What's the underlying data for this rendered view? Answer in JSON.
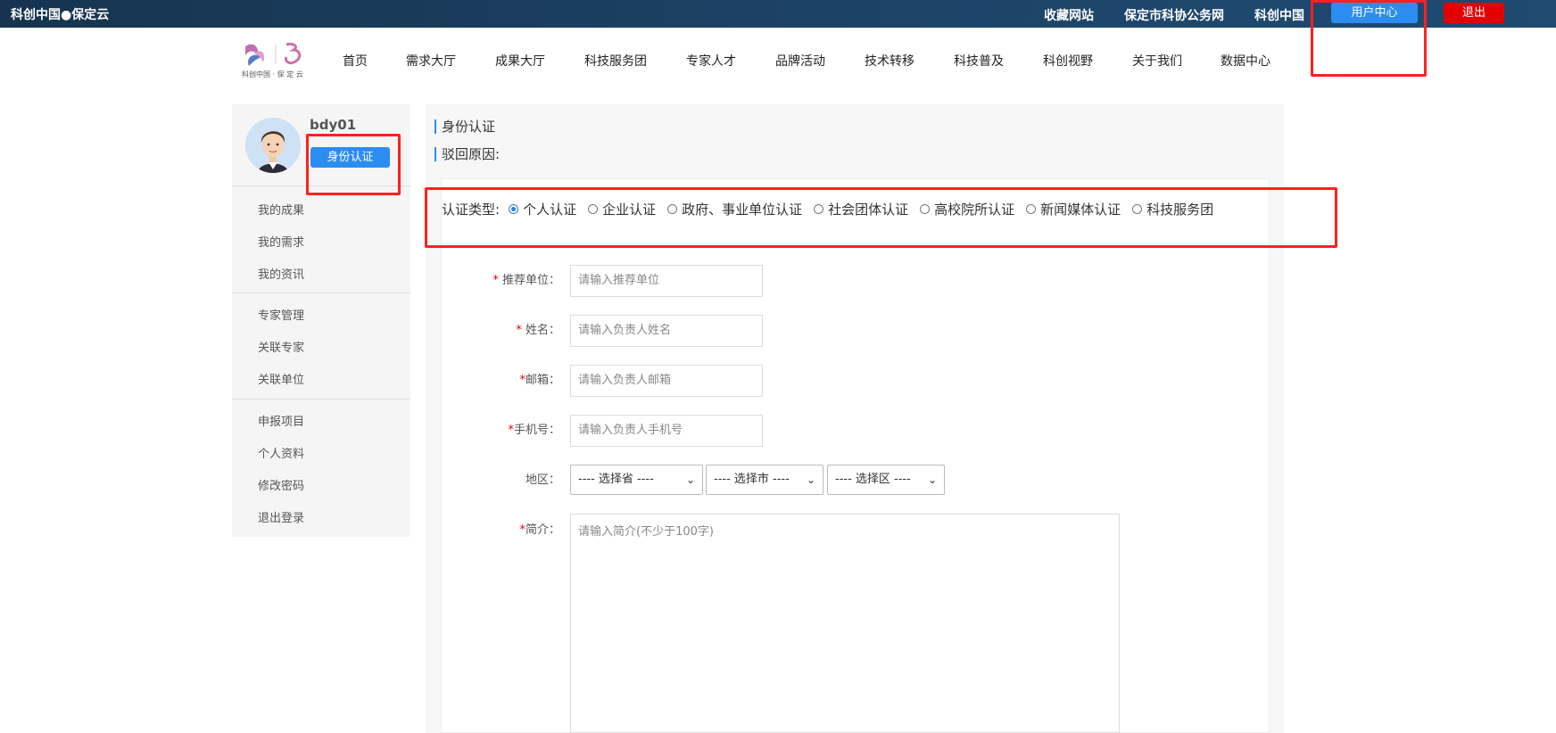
{
  "topbar": {
    "site_name": "科创中国●保定云",
    "links": [
      "收藏网站",
      "保定市科协公务网",
      "科创中国"
    ],
    "user_center": "用户中心",
    "logout": "退出"
  },
  "logo": {
    "text": "科创中国 · 保 定 云"
  },
  "nav": [
    "首页",
    "需求大厅",
    "成果大厅",
    "科技服务团",
    "专家人才",
    "品牌活动",
    "技术转移",
    "科技普及",
    "科创视野",
    "关于我们",
    "数据中心"
  ],
  "sidebar": {
    "username": "bdy01",
    "verify_button": "身份认证",
    "groups": [
      [
        "我的成果",
        "我的需求",
        "我的资讯"
      ],
      [
        "专家管理",
        "关联专家",
        "关联单位"
      ],
      [
        "申报项目",
        "个人资料",
        "修改密码",
        "退出登录"
      ]
    ]
  },
  "main": {
    "title": "身份认证",
    "reject_reason_label": "驳回原因:",
    "cert_type_label": "认证类型:",
    "cert_types": [
      "个人认证",
      "企业认证",
      "政府、事业单位认证",
      "社会团体认证",
      "高校院所认证",
      "新闻媒体认证",
      "科技服务团"
    ],
    "cert_selected": "个人认证",
    "fields": {
      "recommend_unit": {
        "label": "推荐单位：",
        "required": "*",
        "placeholder": "请输入推荐单位"
      },
      "name": {
        "label": "姓名：",
        "required": "*",
        "placeholder": "请输入负责人姓名"
      },
      "email": {
        "label": "邮箱：",
        "required": "*",
        "placeholder": "请输入负责人邮箱"
      },
      "phone": {
        "label": "手机号：",
        "required": "*",
        "placeholder": "请输入负责人手机号"
      },
      "region": {
        "label": "地区：",
        "province": "---- 选择省 ----",
        "city": "---- 选择市 ----",
        "district": "---- 选择区 ----"
      },
      "intro": {
        "label": "简介：",
        "required": "*",
        "placeholder": "请输入简介(不少于100字)"
      }
    }
  },
  "colors": {
    "accent": "#2c8df0",
    "danger": "#e50000",
    "annotation": "#ff2020",
    "topbar": "#1d4469"
  }
}
